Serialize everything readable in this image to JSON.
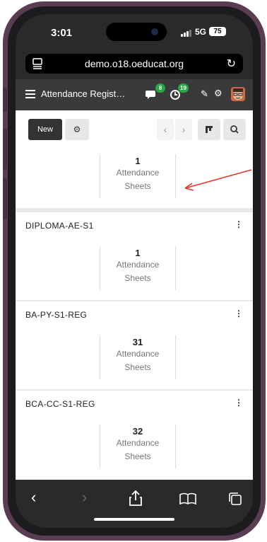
{
  "status": {
    "time": "3:01",
    "network": "5G",
    "battery": "75"
  },
  "browser": {
    "url": "demo.o18.oeducat.org"
  },
  "header": {
    "title": "Attendance Regist…",
    "messages_badge": "8",
    "activity_badge": "19"
  },
  "toolbar": {
    "new_label": "New"
  },
  "groups": [
    {
      "name": "",
      "count": "1",
      "label_line1": "Attendance",
      "label_line2": "Sheets"
    },
    {
      "name": "DIPLOMA-AE-S1",
      "count": "1",
      "label_line1": "Attendance",
      "label_line2": "Sheets"
    },
    {
      "name": "BA-PY-S1-REG",
      "count": "31",
      "label_line1": "Attendance",
      "label_line2": "Sheets"
    },
    {
      "name": "BCA-CC-S1-REG",
      "count": "32",
      "label_line1": "Attendance",
      "label_line2": "Sheets"
    }
  ],
  "annotation": {
    "color": "#e0392b"
  },
  "icons": {
    "menu": "hamburger-icon",
    "messages": "chat-icon",
    "activity": "clock-icon",
    "tools": "wrench-icon",
    "settings": "gear-icon",
    "back": "chevron-left-icon",
    "forward": "chevron-right-icon",
    "share": "share-icon",
    "bookmarks": "book-icon",
    "tabs": "tabs-icon"
  },
  "colors": {
    "badge": "#28a745",
    "header": "#3a3a3a",
    "new_button": "#333333"
  }
}
